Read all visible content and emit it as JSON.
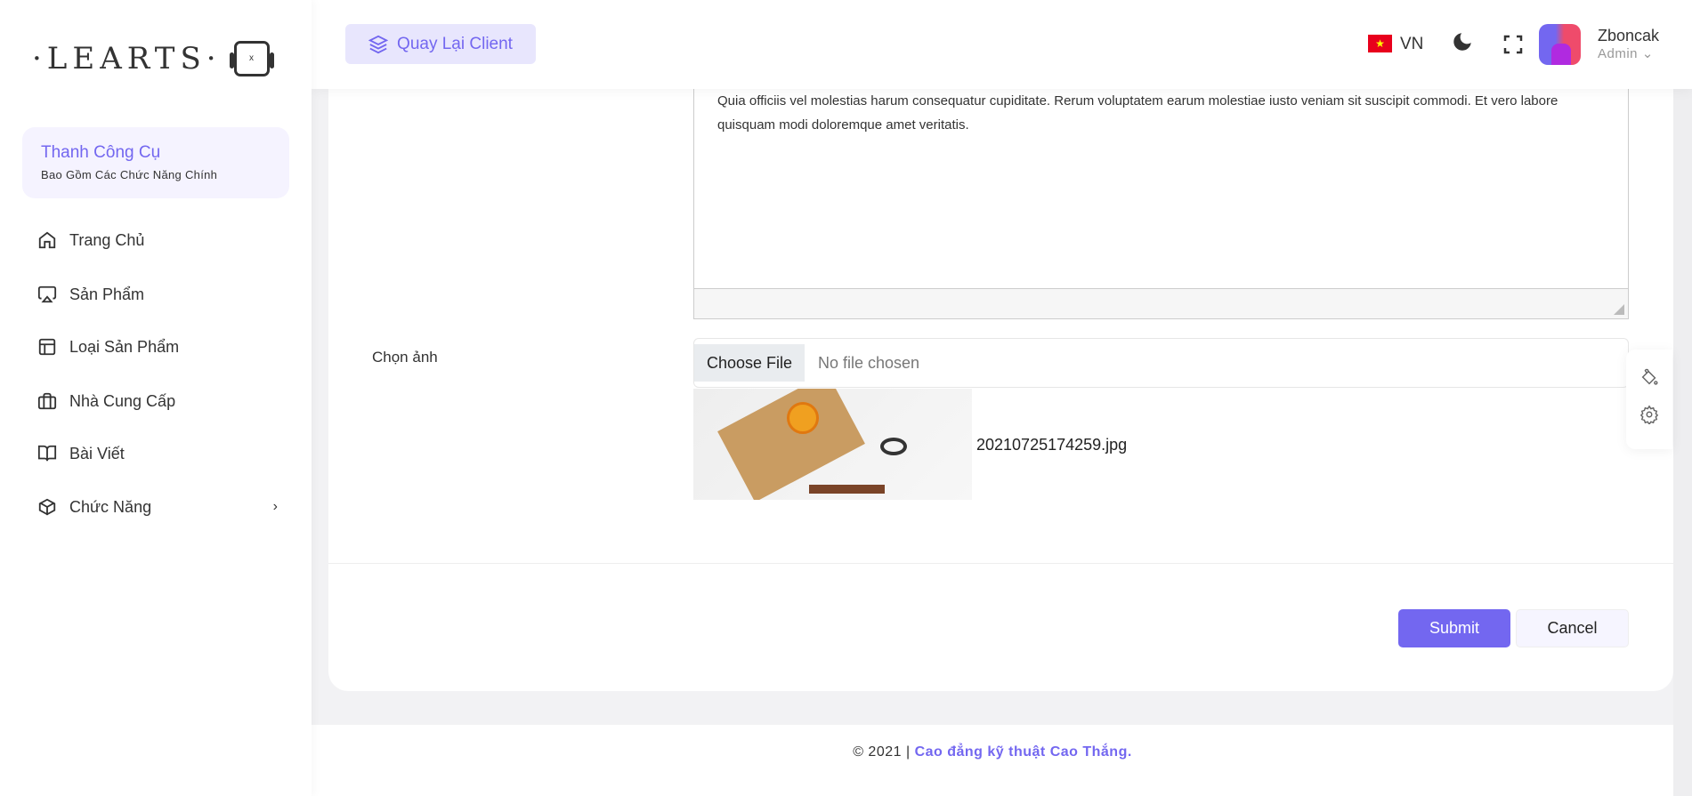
{
  "logo": {
    "text": "·LEARTS·",
    "robot_mark": "x"
  },
  "sidebar": {
    "card": {
      "title": "Thanh Công Cụ",
      "subtitle": "Bao Gồm Các Chức Năng Chính"
    },
    "items": [
      {
        "label": "Trang Chủ",
        "icon": "home-icon"
      },
      {
        "label": "Sản Phẩm",
        "icon": "airplay-icon"
      },
      {
        "label": "Loại Sản Phẩm",
        "icon": "layout-icon"
      },
      {
        "label": "Nhà Cung Cấp",
        "icon": "briefcase-icon"
      },
      {
        "label": "Bài Viết",
        "icon": "book-open-icon"
      },
      {
        "label": "Chức Năng",
        "icon": "box-icon",
        "chevron": "›"
      }
    ]
  },
  "header": {
    "back_label": "Quay Lại Client",
    "lang": "VN",
    "flag_star": "★",
    "user": {
      "name": "Zboncak",
      "role": "Admin"
    }
  },
  "form": {
    "description": "Quia officiis vel molestias harum consequatur cupiditate. Rerum voluptatem earum molestiae iusto veniam sit suscipit commodi. Et vero labore quisquam modi doloremque amet veritatis.",
    "image_label": "Chọn ảnh",
    "file_button": "Choose File",
    "file_status": "No file chosen",
    "current_file": "20210725174259.jpg",
    "submit": "Submit",
    "cancel": "Cancel"
  },
  "footer": {
    "copyright": "© 2021 | ",
    "brand": "Cao đẳng kỹ thuật Cao Thắng."
  },
  "colors": {
    "accent": "#7367f0"
  }
}
